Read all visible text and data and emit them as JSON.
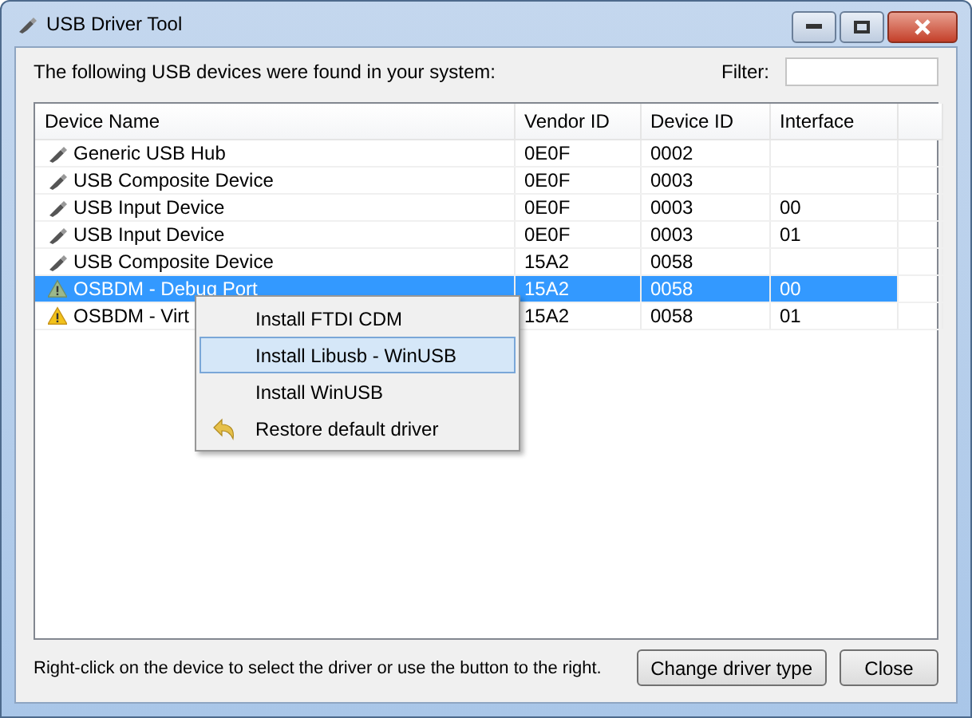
{
  "window": {
    "title": "USB Driver Tool"
  },
  "intro": "The following USB devices were found in your system:",
  "filter": {
    "label": "Filter:"
  },
  "table": {
    "columns": [
      "Device Name",
      "Vendor ID",
      "Device ID",
      "Interface"
    ],
    "rows": [
      {
        "kind": "usb",
        "name": "Generic USB Hub",
        "vendor": "0E0F",
        "device": "0002",
        "interface": "",
        "selected": false
      },
      {
        "kind": "usb",
        "name": "USB Composite Device",
        "vendor": "0E0F",
        "device": "0003",
        "interface": "",
        "selected": false
      },
      {
        "kind": "usb",
        "name": "USB Input Device",
        "vendor": "0E0F",
        "device": "0003",
        "interface": "00",
        "selected": false
      },
      {
        "kind": "usb",
        "name": "USB Input Device",
        "vendor": "0E0F",
        "device": "0003",
        "interface": "01",
        "selected": false
      },
      {
        "kind": "usb",
        "name": "USB Composite Device",
        "vendor": "15A2",
        "device": "0058",
        "interface": "",
        "selected": false
      },
      {
        "kind": "warning",
        "name": "OSBDM - Debug Port",
        "vendor": "15A2",
        "device": "0058",
        "interface": "00",
        "selected": true
      },
      {
        "kind": "warning",
        "name": "OSBDM - Virt",
        "vendor": "15A2",
        "device": "0058",
        "interface": "01",
        "selected": false
      }
    ]
  },
  "context_menu": [
    {
      "kind": "plain",
      "label": "Install FTDI CDM",
      "highlighted": false
    },
    {
      "kind": "plain",
      "label": "Install Libusb - WinUSB",
      "highlighted": true
    },
    {
      "kind": "plain",
      "label": "Install WinUSB",
      "highlighted": false
    },
    {
      "kind": "undo",
      "label": "Restore default driver",
      "highlighted": false
    }
  ],
  "hint": "Right-click on the device to select the driver or use the button to the right.",
  "buttons": [
    "Change driver type",
    "Close"
  ]
}
